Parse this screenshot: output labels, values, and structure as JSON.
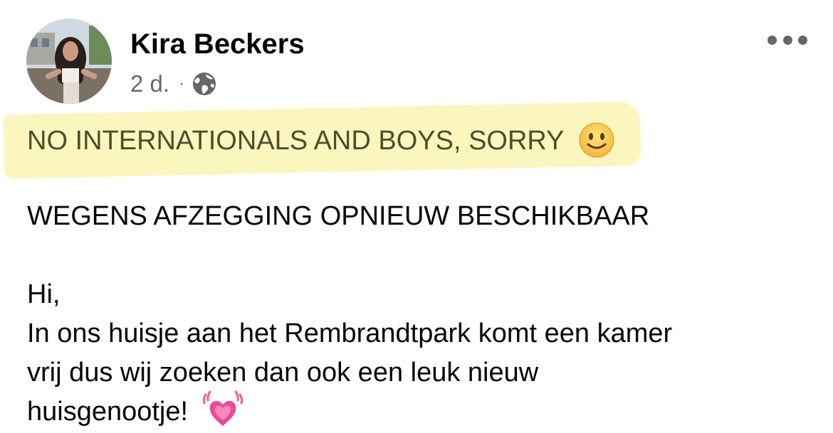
{
  "post": {
    "author": "Kira Beckers",
    "time": "2 d.",
    "separator": "·",
    "audience_icon": "globe-icon",
    "menu_icon": "more-options-icon",
    "highlighted_line": "NO INTERNATIONALS AND BOYS, SORRY",
    "highlighted_emoji": "slightly-smiling-face-emoji",
    "highlight_color": "#fbf6bd",
    "body_lines": [
      "WEGENS AFZEGGING OPNIEUW BESCHIKBAAR",
      "Hi,",
      "In ons huisje aan het Rembrandtpark komt een kamer",
      "vrij dus wij zoeken dan ook een leuk nieuw",
      "huisgenootje!"
    ],
    "body_emoji": "beating-heart-emoji"
  }
}
